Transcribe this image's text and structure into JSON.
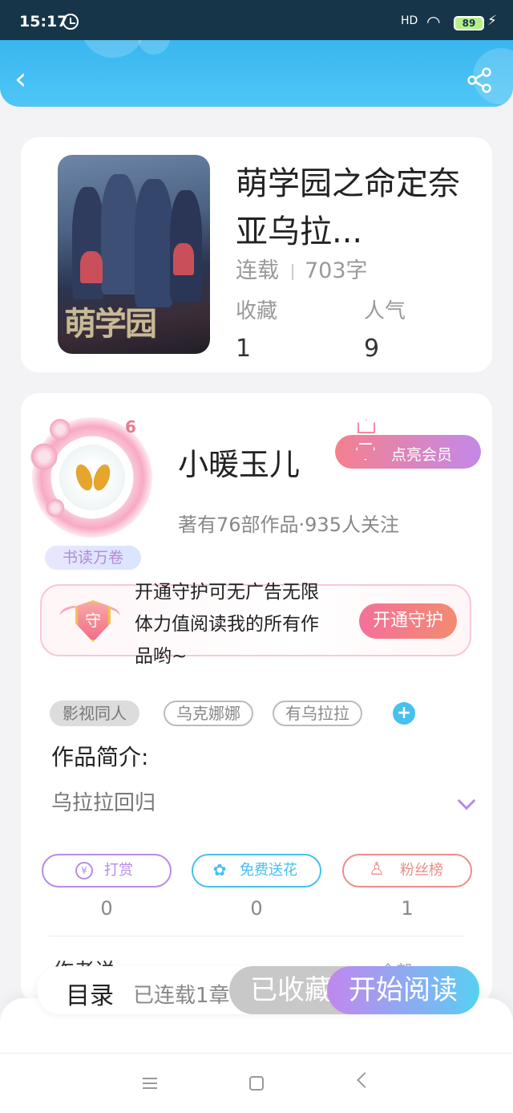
{
  "status_bar": {
    "time": "15:17",
    "signal": "HD",
    "battery": "89"
  },
  "header": {
    "back_icon": "back-arrow-icon",
    "share_icon": "share-icon"
  },
  "book": {
    "title": "萌学园之命定奈亚乌拉...",
    "status": "连载",
    "word_count": "703字",
    "favorites_label": "收藏",
    "favorites_value": "1",
    "popularity_label": "人气",
    "popularity_value": "9",
    "cover_text": "萌学园"
  },
  "author": {
    "name": "小暖玉儿",
    "level": "6",
    "badge": "书读万卷",
    "vip_button": "点亮会员",
    "stats": "著有76部作品·935人关注"
  },
  "guard": {
    "shield_char": "守",
    "text": "开通守护可无广告无限体力值阅读我的所有作品哟~",
    "button": "开通守护"
  },
  "tags": [
    "影视同人",
    "乌克娜娜",
    "有乌拉拉"
  ],
  "intro": {
    "title": "作品简介:",
    "body": "乌拉拉回归"
  },
  "actions": [
    {
      "label": "打赏",
      "icon": "¥",
      "count": "0",
      "color": "#b78be6"
    },
    {
      "label": "免费送花",
      "icon": "✿",
      "count": "0",
      "color": "#46c0ef"
    },
    {
      "label": "粉丝榜",
      "icon": "♙",
      "count": "1",
      "color": "#ee8c8c"
    }
  ],
  "section_peek": {
    "title": "作者说",
    "more": "全部 >"
  },
  "bottom_bar": {
    "toc": "目录",
    "chapters": "已连载1章",
    "favorited": "已收藏",
    "start_reading": "开始阅读"
  }
}
